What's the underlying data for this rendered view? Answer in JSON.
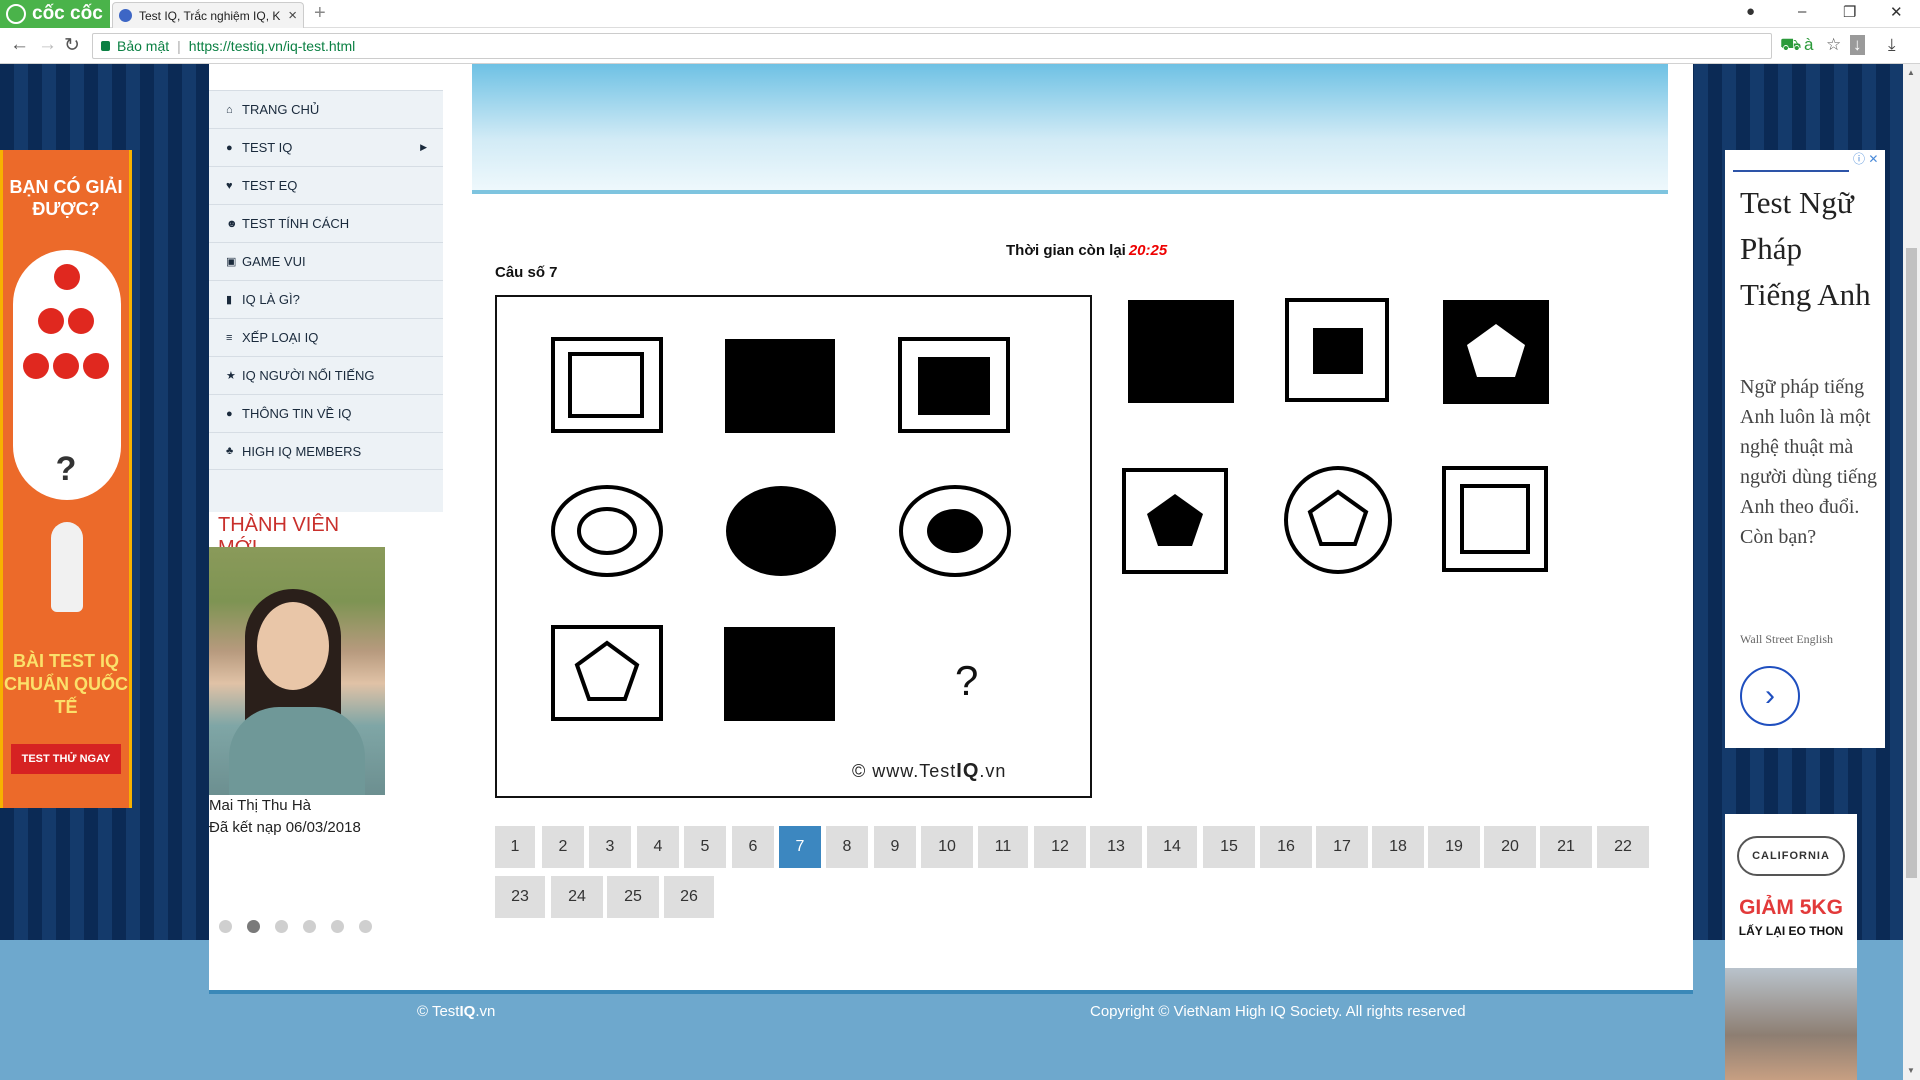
{
  "browser": {
    "brand": "cốc cốc",
    "tab_title": "Test IQ, Trắc nghiệm IQ, K",
    "secure_label": "Bảo mật",
    "url": "https://testiq.vn/iq-test.html"
  },
  "sidebar": {
    "items": [
      {
        "label": "TRANG CHỦ",
        "icon": "home-icon",
        "glyph": "⌂"
      },
      {
        "label": "TEST IQ",
        "icon": "brain-icon",
        "glyph": "●",
        "has_submenu": true
      },
      {
        "label": "TEST EQ",
        "icon": "heart-icon",
        "glyph": "♥"
      },
      {
        "label": "TEST TÍNH CÁCH",
        "icon": "users-icon",
        "glyph": "☻"
      },
      {
        "label": "GAME VUI",
        "icon": "gamepad-icon",
        "glyph": "▣"
      },
      {
        "label": "IQ LÀ GÌ?",
        "icon": "book-icon",
        "glyph": "▮"
      },
      {
        "label": "XẾP LOẠI IQ",
        "icon": "list-icon",
        "glyph": "≡"
      },
      {
        "label": "IQ NGƯỜI NỔI TIẾNG",
        "icon": "star-icon",
        "glyph": "★"
      },
      {
        "label": "THÔNG TIN VỀ IQ",
        "icon": "info-icon",
        "glyph": "●"
      },
      {
        "label": "HIGH IQ MEMBERS",
        "icon": "group-icon",
        "glyph": "♣"
      }
    ],
    "members_title": "THÀNH VIÊN MỚI",
    "member_name": "Mai Thị Thu Hà",
    "member_date": "Đã kết nạp 06/03/2018",
    "carousel_active_index": 1
  },
  "quiz": {
    "timer_label": "Thời gian còn lại",
    "timer_value": "20:25",
    "question_label": "Câu số 7",
    "watermark_prefix": "© www.Test",
    "watermark_bold": "IQ",
    "watermark_suffix": ".vn",
    "question_mark": "?",
    "pages": [
      "1",
      "2",
      "3",
      "4",
      "5",
      "6",
      "7",
      "8",
      "9",
      "10",
      "11",
      "12",
      "13",
      "14",
      "15",
      "16",
      "17",
      "18",
      "19",
      "20",
      "21",
      "22",
      "23",
      "24",
      "25",
      "26"
    ],
    "current_page": "7"
  },
  "footer": {
    "left_prefix": "© Test",
    "left_bold": "IQ",
    "left_suffix": ".vn",
    "right": "Copyright © VietNam High IQ Society. All rights reserved"
  },
  "ad_left": {
    "headline": "BẠN CÓ GIẢI ĐƯỢC?",
    "question_mark": "?",
    "caption": "BÀI TEST IQ CHUẨN QUỐC TẾ",
    "cta": "TEST THỬ NGAY"
  },
  "ad_right": {
    "headline": "Test Ngữ Pháp Tiếng Anh",
    "body": "Ngữ pháp tiếng Anh luôn là một nghệ thuật mà người dùng tiếng Anh theo đuổi. Còn bạn?",
    "source": "Wall Street English",
    "info_icon": "ⓘ ✕",
    "go_icon": "›"
  },
  "ad_right2": {
    "logo": "CALIFORNIA",
    "big": "GIẢM 5KG",
    "small": "LẤY LẠI EO THON"
  }
}
